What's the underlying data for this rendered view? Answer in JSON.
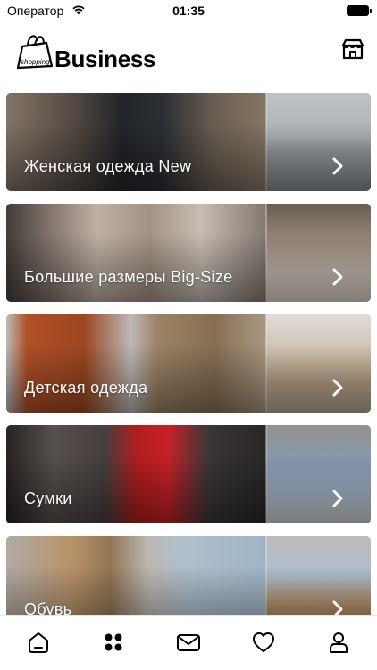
{
  "status_bar": {
    "carrier": "Оператор",
    "time": "01:35",
    "wifi_icon": "wifi-icon",
    "battery_icon": "battery-icon"
  },
  "header": {
    "logo_bag_text": "shopping",
    "logo_text": "Business",
    "store_icon": "store-icon"
  },
  "categories": [
    {
      "label": "Женская одежда New"
    },
    {
      "label": "Большие размеры Big-Size"
    },
    {
      "label": "Детская одежда"
    },
    {
      "label": "Сумки"
    },
    {
      "label": "Обувь"
    }
  ],
  "tab_bar": {
    "items": [
      {
        "icon": "home-icon"
      },
      {
        "icon": "catalog-grid-icon"
      },
      {
        "icon": "mail-icon"
      },
      {
        "icon": "heart-icon"
      },
      {
        "icon": "profile-icon"
      }
    ]
  },
  "colors": {
    "background": "#ffffff",
    "text": "#000000",
    "card_label": "#ffffff"
  }
}
